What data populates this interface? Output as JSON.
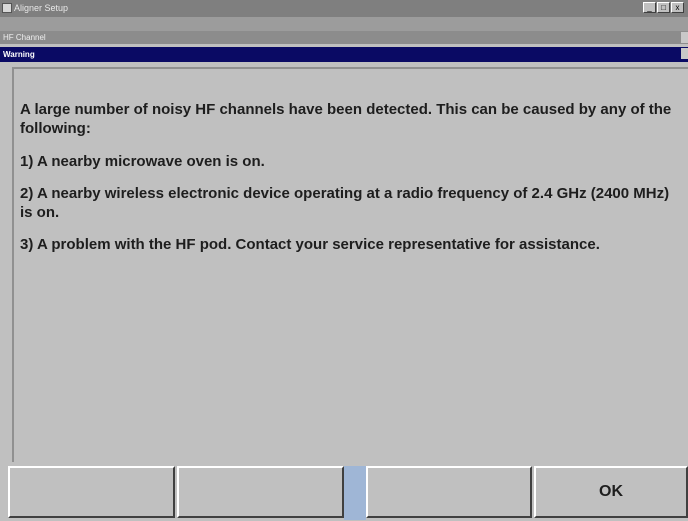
{
  "window": {
    "app_title": "Aligner Setup",
    "hf_title": "HF Channel",
    "dialog_title": "Warning",
    "controls": [
      "_",
      "□",
      "x"
    ]
  },
  "message": {
    "intro": "A large number of noisy HF channels have been detected. This can be caused by any of the following:",
    "causes": [
      "1) A nearby microwave oven is on.",
      "2) A nearby wireless electronic device operating at a radio frequency of 2.4 GHz (2400 MHz) is on.",
      "3) A problem with the HF pod. Contact your service representative for assistance."
    ]
  },
  "buttons": {
    "f1": "",
    "f2": "",
    "f3": "",
    "ok": "OK"
  }
}
